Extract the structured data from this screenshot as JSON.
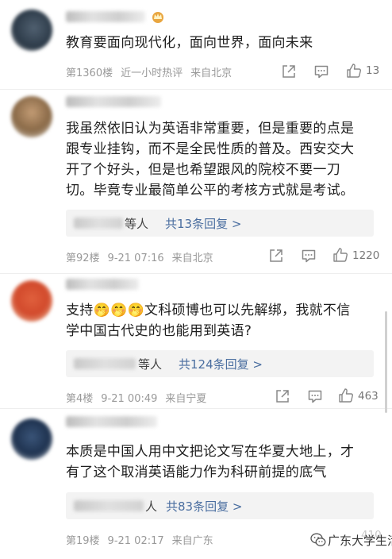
{
  "comments": [
    {
      "text_lines": [
        "教育要面向现代化，面向世界，面向未来"
      ],
      "floor": "第1360楼",
      "time": "近一小时热评",
      "location": "来自北京",
      "likes": "13",
      "avatar_color": "#2c3a48",
      "has_crown": true
    },
    {
      "text_lines": [
        "我虽然依旧认为英语非常重要，但是重要的点是",
        "跟专业挂钩，而不是全民性质的普及。西安交大",
        "开了个好头，但是也希望跟风的院校不要一刀",
        "切。毕竟专业最简单公平的考核方式就是考试。"
      ],
      "reply_who": "等人",
      "reply_count": "共13条回复 >",
      "floor": "第92楼",
      "time": "9-21 07:16",
      "location": "来自北京",
      "likes": "1220",
      "avatar_color": "#8a6a48"
    },
    {
      "text_prefix": "支持",
      "emoji": [
        "🤭",
        "🤭",
        "🤭"
      ],
      "text_after_emoji": "文科硕博也可以先解绑，我就不信",
      "text_line2": "学中国古代史的也能用到英语?",
      "reply_who": "等人",
      "reply_count": "共124条回复 >",
      "floor": "第4楼",
      "time": "9-21 00:49",
      "location": "来自宁夏",
      "likes": "463",
      "avatar_color": "#d24a2c"
    },
    {
      "text_lines": [
        "本质是中国人用中文把论文写在华夏大地上，才",
        "有了这个取消英语能力作为科研前提的底气"
      ],
      "reply_who": "人",
      "reply_count": "共83条回复 >",
      "floor": "第19楼",
      "time": "9-21 02:17",
      "location": "来自广东",
      "likes": "410",
      "avatar_color": "#1f3350"
    }
  ],
  "watermark": {
    "text": "广东大学生活",
    "icon": "wechat-logo-icon"
  },
  "icons": {
    "share": "share-icon",
    "comment": "comment-icon",
    "like": "thumbs-up-icon",
    "crown": "crown-icon"
  },
  "colors": {
    "link_blue": "#4a6ea0",
    "meta_gray": "#999999",
    "reply_bg": "#f3f3f3"
  }
}
